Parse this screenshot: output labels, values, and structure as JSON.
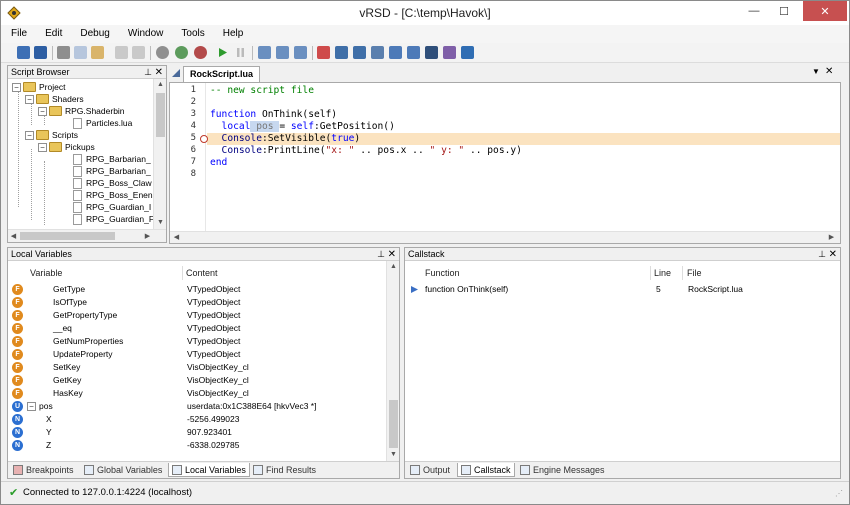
{
  "app": {
    "title": "vRSD - [C:\\temp\\Havok\\]",
    "window_controls": {
      "minimize": "—",
      "maximize": "☐",
      "close": "✕"
    }
  },
  "menu": [
    "File",
    "Edit",
    "Debug",
    "Window",
    "Tools",
    "Help"
  ],
  "script_browser": {
    "title": "Script Browser",
    "tree": [
      {
        "label": "Project",
        "type": "folder",
        "level": 0,
        "expanded": true
      },
      {
        "label": "Shaders",
        "type": "folder",
        "level": 1,
        "expanded": true
      },
      {
        "label": "RPG.Shaderbin",
        "type": "folder",
        "level": 2,
        "expanded": true
      },
      {
        "label": "Particles.lua",
        "type": "file",
        "level": 3
      },
      {
        "label": "Scripts",
        "type": "folder",
        "level": 1,
        "expanded": true
      },
      {
        "label": "Pickups",
        "type": "folder",
        "level": 2,
        "expanded": true
      },
      {
        "label": "RPG_Barbarian_",
        "type": "file",
        "level": 3
      },
      {
        "label": "RPG_Barbarian_",
        "type": "file",
        "level": 3
      },
      {
        "label": "RPG_Boss_Claw",
        "type": "file",
        "level": 3
      },
      {
        "label": "RPG_Boss_Enen",
        "type": "file",
        "level": 3
      },
      {
        "label": "RPG_Guardian_I",
        "type": "file",
        "level": 3
      },
      {
        "label": "RPG_Guardian_F",
        "type": "file",
        "level": 3
      }
    ]
  },
  "editor": {
    "tab_label": "RockScript.lua",
    "line_numbers": [
      "1",
      "2",
      "3",
      "4",
      "5",
      "6",
      "7",
      "8"
    ],
    "breakpoint_line": 5,
    "highlight_color": "#fbe3c0",
    "lines": {
      "l1_comment": "-- new script file",
      "l3_kw": "function",
      "l3_name": " OnThink(self)",
      "l4_kw": "  local",
      "l4_sel": " pos ",
      "l4_rest": "= ",
      "l4_self": "self",
      "l4_call": ":GetPosition()",
      "l5_obj": "  Console",
      "l5_call": ":SetVisible(",
      "l5_kw": "true",
      "l5_end": ")",
      "l6_obj": "  Console",
      "l6_call": ":PrintLine(",
      "l6_s1": "\"x: \"",
      "l6_m1": " .. pos.x .. ",
      "l6_s2": "\" y: \"",
      "l6_m2": " .. pos.y)",
      "l7_kw": "end"
    }
  },
  "local_variables": {
    "title": "Local Variables",
    "columns": [
      "Variable",
      "Content"
    ],
    "rows": [
      {
        "icon": "F",
        "name": "GetType",
        "content": "VTypedObject"
      },
      {
        "icon": "F",
        "name": "IsOfType",
        "content": "VTypedObject"
      },
      {
        "icon": "F",
        "name": "GetPropertyType",
        "content": "VTypedObject"
      },
      {
        "icon": "F",
        "name": "__eq",
        "content": "VTypedObject"
      },
      {
        "icon": "F",
        "name": "GetNumProperties",
        "content": "VTypedObject"
      },
      {
        "icon": "F",
        "name": "UpdateProperty",
        "content": "VTypedObject"
      },
      {
        "icon": "F",
        "name": "SetKey",
        "content": "VisObjectKey_cl"
      },
      {
        "icon": "F",
        "name": "GetKey",
        "content": "VisObjectKey_cl"
      },
      {
        "icon": "F",
        "name": "HasKey",
        "content": "VisObjectKey_cl"
      },
      {
        "icon": "U",
        "name": "pos",
        "content": "userdata:0x1C388E64 [hkvVec3 *]",
        "expander": "−"
      },
      {
        "icon": "N",
        "name": "X",
        "content": "-5256.499023"
      },
      {
        "icon": "N",
        "name": "Y",
        "content": "907.923401"
      },
      {
        "icon": "N",
        "name": "Z",
        "content": "-6338.029785"
      }
    ],
    "tabs": [
      "Breakpoints",
      "Global Variables",
      "Local Variables",
      "Find Results"
    ],
    "active_tab": "Local Variables"
  },
  "callstack": {
    "title": "Callstack",
    "columns": [
      "Function",
      "Line",
      "File"
    ],
    "rows": [
      {
        "function": "function OnThink(self)",
        "line": "5",
        "file": "RockScript.lua"
      }
    ],
    "tabs": [
      "Output",
      "Callstack",
      "Engine Messages"
    ],
    "active_tab": "Callstack"
  },
  "status": {
    "text": "Connected to 127.0.0.1:4224 (localhost)",
    "icon": "check-icon"
  }
}
